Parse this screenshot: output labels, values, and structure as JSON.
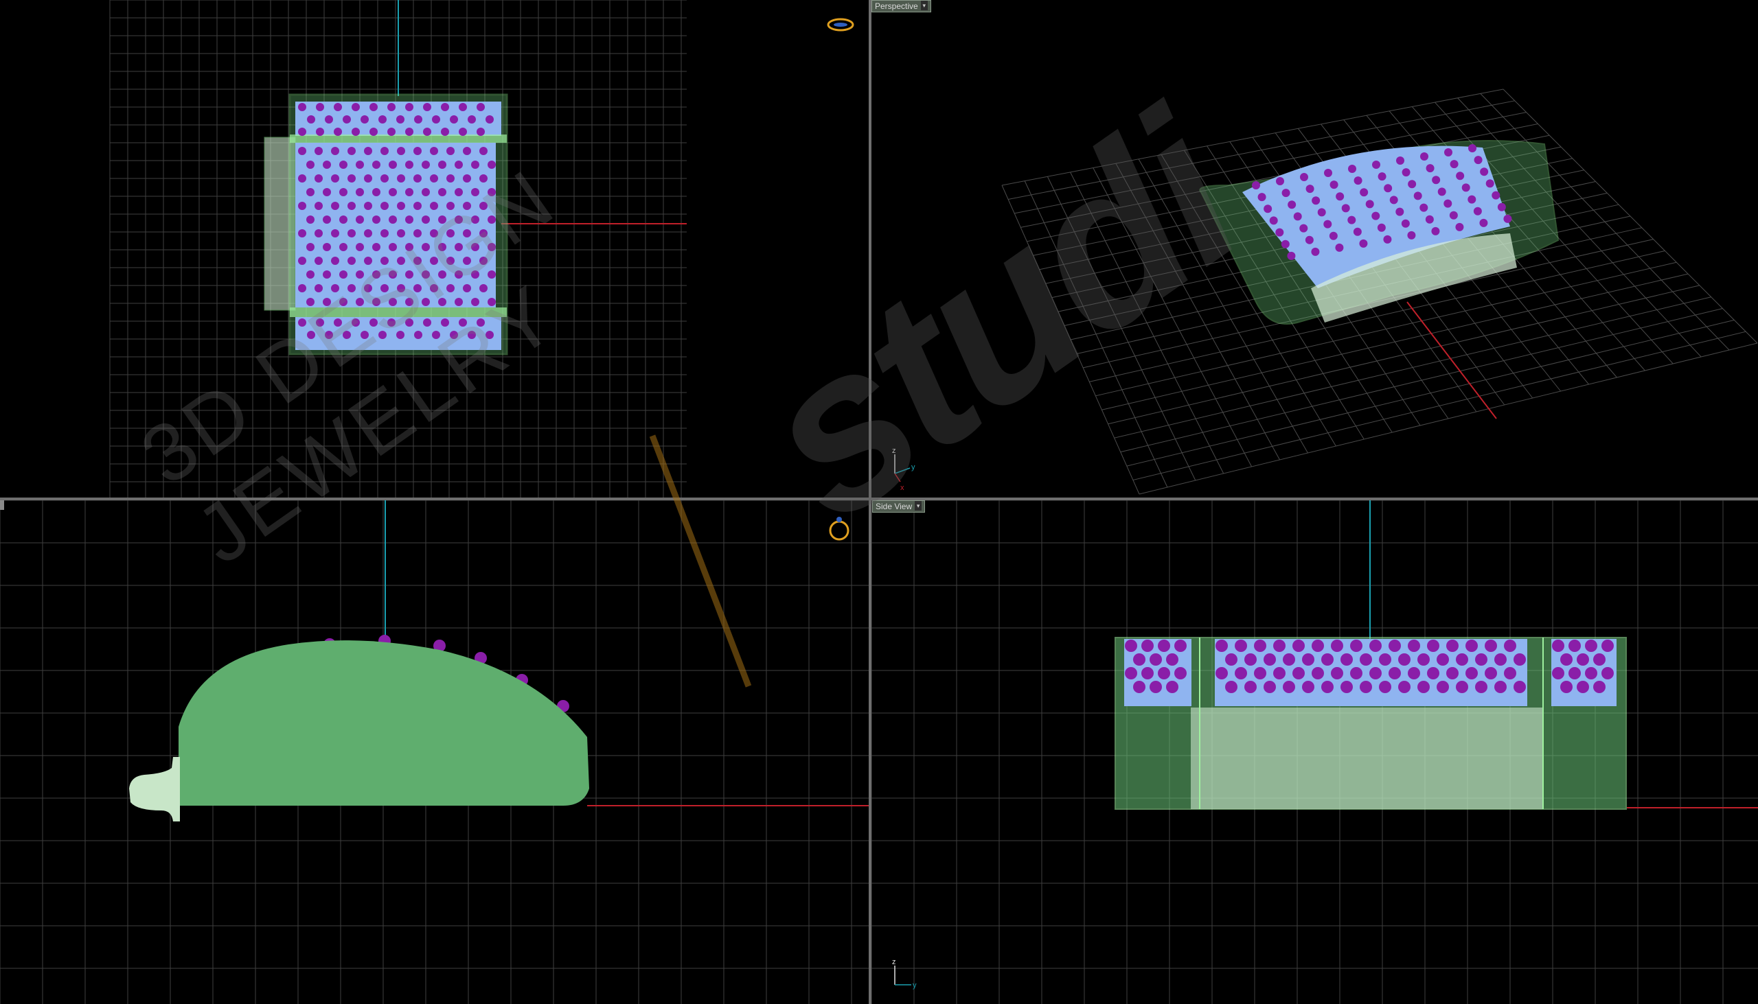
{
  "viewports": {
    "top": {
      "label": ""
    },
    "perspective": {
      "label": "Perspective",
      "dropdown": "▾"
    },
    "front": {
      "label": ""
    },
    "side": {
      "label": "Side View",
      "dropdown": "▾"
    }
  },
  "axes": {
    "perspective": {
      "z": "z",
      "y": "y",
      "x": "x"
    },
    "side": {
      "z": "z",
      "y": "y"
    }
  },
  "watermark": {
    "line1": "3D DESIGN",
    "line2": "JEWELRY",
    "brand": "studi"
  },
  "icons": {
    "top_view_nav": "ring-top-icon",
    "front_view_nav": "ring-side-icon"
  },
  "colors": {
    "grid": "#3a3a3a",
    "grid_major": "#5a5a5a",
    "axis_x": "#c0202a",
    "axis_y": "#1aa0b0",
    "metal": "#6cc87a",
    "metal_fill": "#5fae6e",
    "stone_blue": "#8fb4f0",
    "stone_purple": "#8a1ea8"
  }
}
